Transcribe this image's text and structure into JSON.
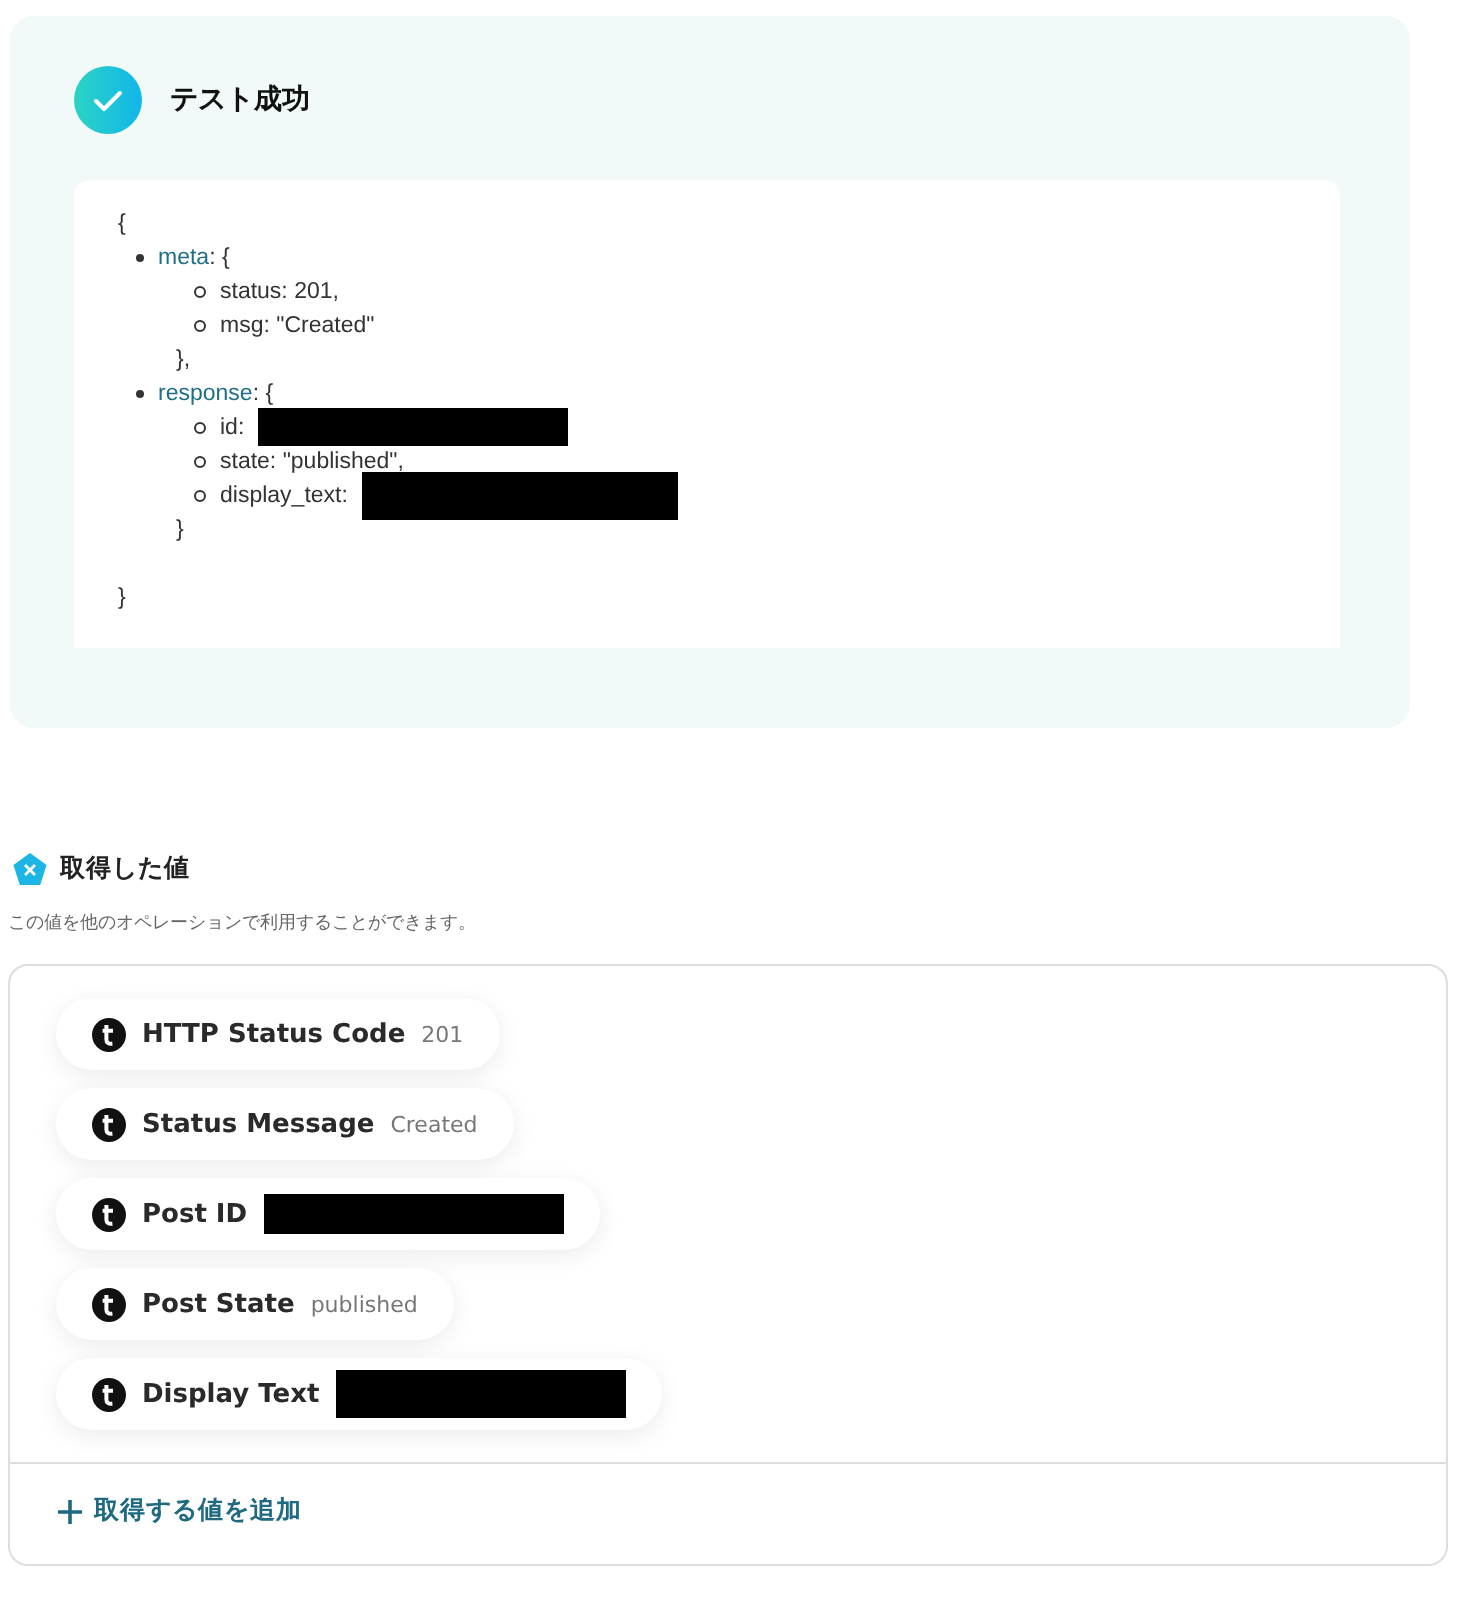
{
  "result": {
    "success": true,
    "title": "テスト成功",
    "code": {
      "open": "{",
      "close": "}",
      "entries": [
        {
          "key": "meta",
          "suffix": ": {",
          "close": "},",
          "children": [
            {
              "kind": "text",
              "text": "status: 201,"
            },
            {
              "kind": "text",
              "text": "msg: \"Created\""
            }
          ]
        },
        {
          "key": "response",
          "suffix": ": {",
          "close": "}",
          "children": [
            {
              "kind": "redacted",
              "text": "id:"
            },
            {
              "kind": "text",
              "text": "state: \"published\","
            },
            {
              "kind": "redacted",
              "text": "display_text:"
            }
          ]
        }
      ]
    }
  },
  "values_section": {
    "title": "取得した値",
    "description": "この値を他のオペレーションで利用することができます。",
    "items": [
      {
        "label": "HTTP Status Code",
        "kind": "text",
        "value": "201"
      },
      {
        "label": "Status Message",
        "kind": "text",
        "value": "Created"
      },
      {
        "label": "Post ID",
        "kind": "redacted"
      },
      {
        "label": "Post State",
        "kind": "text",
        "value": "published"
      },
      {
        "label": "Display Text",
        "kind": "redacted"
      }
    ],
    "add_button": "取得する値を追加"
  }
}
